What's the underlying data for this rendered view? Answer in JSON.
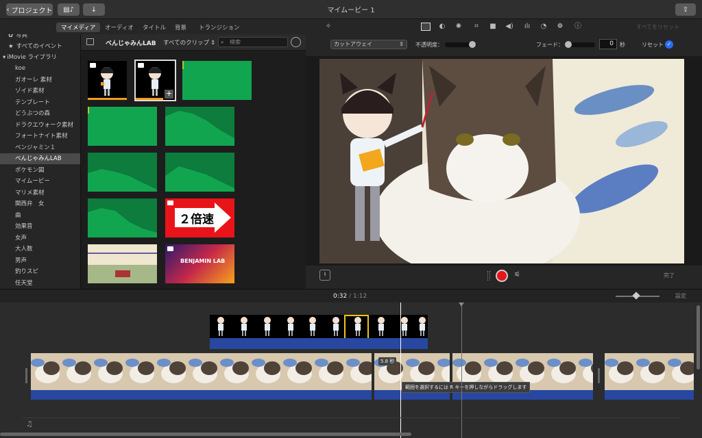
{
  "app": {
    "title": "マイムービー 1",
    "project_button": "プロジェクト"
  },
  "tabs": [
    "マイメディア",
    "オーディオ",
    "タイトル",
    "背景",
    "トランジション"
  ],
  "sidebar": {
    "top_items": [
      "写真",
      "すべてのイベント",
      "iMovie ライブラリ"
    ],
    "items": [
      "koe",
      "ガオーレ 素材",
      "ゾイド素材",
      "テンプレート",
      "どうぶつの森",
      "ドラクエウォーク素材",
      "フォートナイト素材",
      "ベンジャミン１",
      "べんじゃみんLAB",
      "ポケモン図",
      "マイムービー",
      "マリメ素材",
      "関西弁　女",
      "曲",
      "効果音",
      "女声",
      "大人数",
      "男声",
      "釣りスピ",
      "任天堂"
    ],
    "selected_index": 8
  },
  "browser": {
    "library_name": "べんじゃみんLAB",
    "clip_filter": "すべてのクリップ",
    "search_placeholder": "検索",
    "banner_text": "２倍速",
    "logo_text": "BENJAMIN LAB"
  },
  "viewer": {
    "cutaway_label": "カットアウェイ",
    "opacity_label": "不透明度：",
    "fade_label": "フェード：",
    "fade_value": "0",
    "fade_unit": "秒",
    "reset_label": "リセット",
    "reset_all_label": "すべてをリセット",
    "done_label": "完了"
  },
  "timeline": {
    "current_time": "0:32",
    "separator": "/",
    "total_time": "1:12",
    "settings_label": "設定",
    "clip_duration": "5.8 秒",
    "tooltip": "範囲を選択するには R キーを押しながらドラッグします"
  },
  "colors": {
    "accent_blue": "#2a6df5",
    "audio_green": "#12a550",
    "waveform_blue": "#2747a0",
    "record_red": "#e8141a",
    "selection_yellow": "#f0c419"
  }
}
